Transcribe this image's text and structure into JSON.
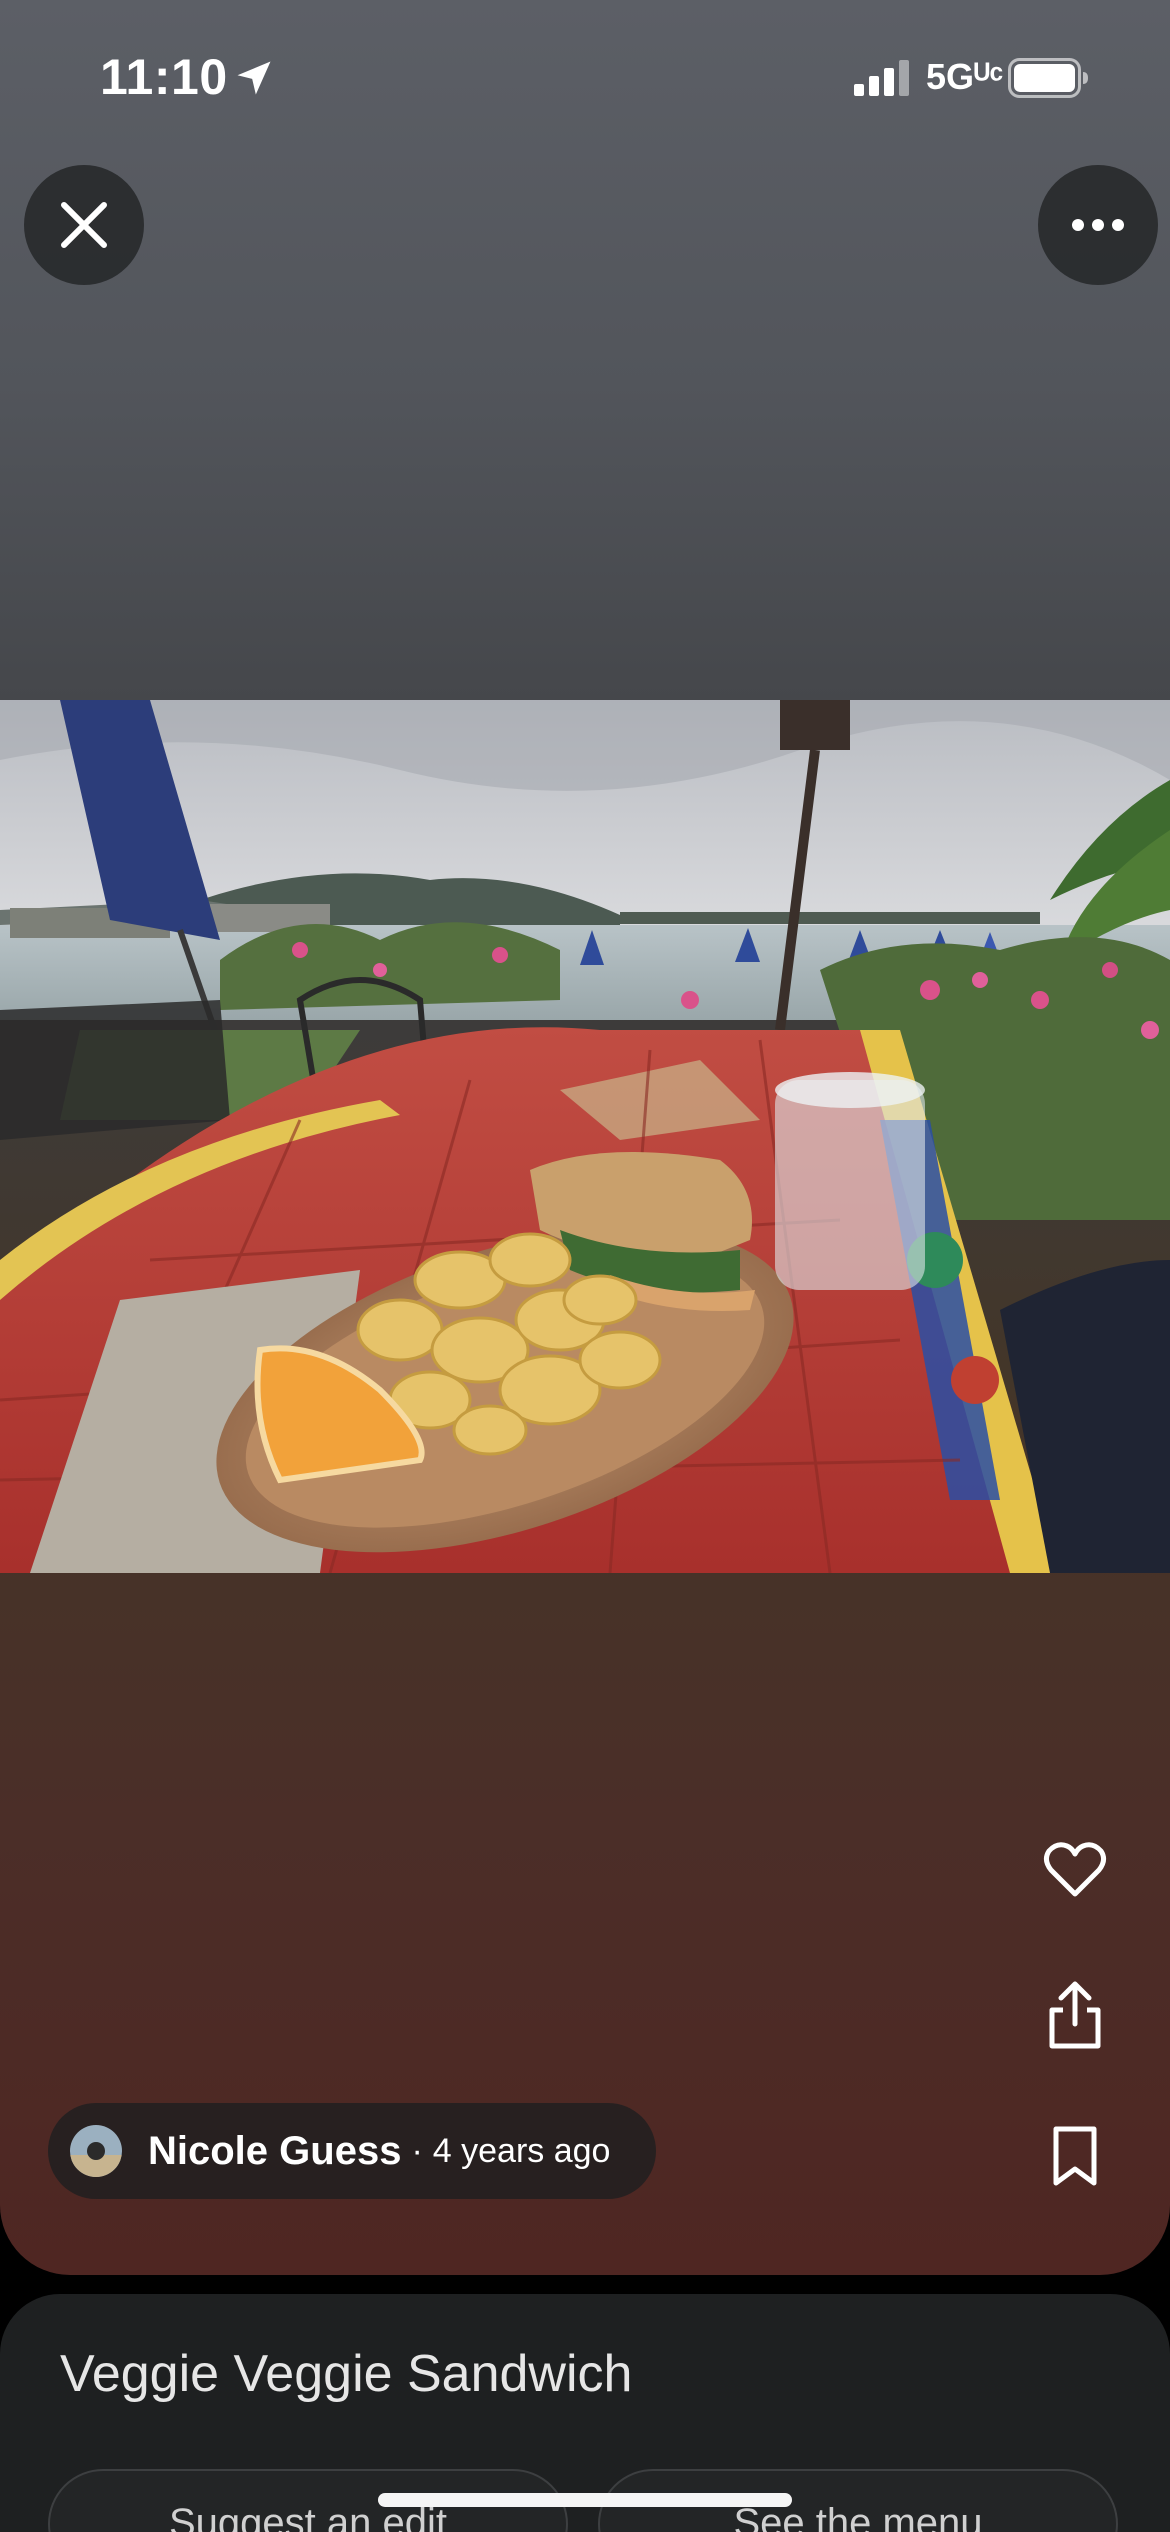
{
  "status_bar": {
    "time": "11:10",
    "network": "5G UC",
    "network_label": "5Gᵁᶜ"
  },
  "viewer": {
    "close_icon": "close-icon",
    "more_icon": "more-horizontal-icon",
    "photo_description_icon": "food-photo"
  },
  "actions": {
    "like_icon": "heart-icon",
    "share_icon": "share-icon",
    "save_icon": "bookmark-icon"
  },
  "author": {
    "name": "Nicole Guess",
    "separator": "·",
    "time_ago": "4 years ago"
  },
  "sheet": {
    "title": "Veggie Veggie Sandwich",
    "suggest_label": "Suggest an edit",
    "menu_label": "See the menu"
  },
  "colors": {
    "sheet_bg": "#1e2021",
    "pill_bg": "#1e1e20"
  }
}
